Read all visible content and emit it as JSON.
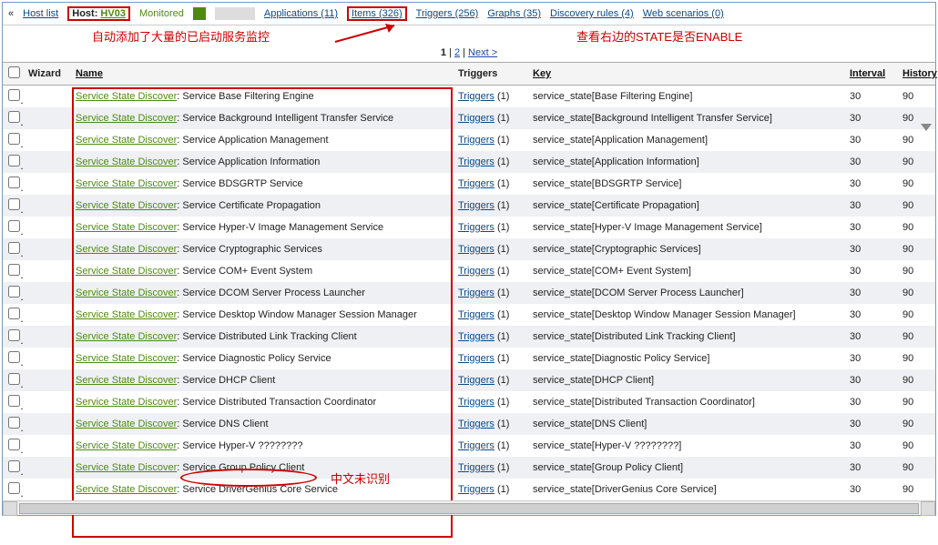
{
  "nav": {
    "host_list": "Host list",
    "host_label": "Host:",
    "host_value": "HV03",
    "monitored": "Monitored",
    "applications": "Applications (11)",
    "items": "Items (326)",
    "triggers": "Triggers (256)",
    "graphs": "Graphs (35)",
    "discovery": "Discovery rules (4)",
    "web": "Web scenarios (0)"
  },
  "annot": {
    "left": "自动添加了大量的已启动服务监控",
    "right": "查看右边的STATE是否ENABLE",
    "cn_unrec": "中文未识别"
  },
  "pager": {
    "p1": "1",
    "p2": "2",
    "next": "Next >"
  },
  "headers": {
    "wizard": "Wizard",
    "name": "Name",
    "triggers": "Triggers",
    "key": "Key",
    "interval": "Interval",
    "history": "History"
  },
  "discover_label": "Service State Discover",
  "triggers_label": "Triggers",
  "triggers_count": "(1)",
  "interval_val": "30",
  "history_val": "90",
  "rows": [
    {
      "svc": "Service Base Filtering Engine",
      "key": "service_state[Base Filtering Engine]"
    },
    {
      "svc": "Service Background Intelligent Transfer Service",
      "key": "service_state[Background Intelligent Transfer Service]"
    },
    {
      "svc": "Service Application Management",
      "key": "service_state[Application Management]"
    },
    {
      "svc": "Service Application Information",
      "key": "service_state[Application Information]"
    },
    {
      "svc": "Service BDSGRTP Service",
      "key": "service_state[BDSGRTP Service]"
    },
    {
      "svc": "Service Certificate Propagation",
      "key": "service_state[Certificate Propagation]"
    },
    {
      "svc": "Service Hyper-V Image Management Service",
      "key": "service_state[Hyper-V Image Management Service]"
    },
    {
      "svc": "Service Cryptographic Services",
      "key": "service_state[Cryptographic Services]"
    },
    {
      "svc": "Service COM+ Event System",
      "key": "service_state[COM+ Event System]"
    },
    {
      "svc": "Service DCOM Server Process Launcher",
      "key": "service_state[DCOM Server Process Launcher]"
    },
    {
      "svc": "Service Desktop Window Manager Session Manager",
      "key": "service_state[Desktop Window Manager Session Manager]"
    },
    {
      "svc": "Service Distributed Link Tracking Client",
      "key": "service_state[Distributed Link Tracking Client]"
    },
    {
      "svc": "Service Diagnostic Policy Service",
      "key": "service_state[Diagnostic Policy Service]"
    },
    {
      "svc": "Service DHCP Client",
      "key": "service_state[DHCP Client]"
    },
    {
      "svc": "Service Distributed Transaction Coordinator",
      "key": "service_state[Distributed Transaction Coordinator]"
    },
    {
      "svc": "Service DNS Client",
      "key": "service_state[DNS Client]"
    },
    {
      "svc": "Service Hyper-V ????????",
      "key": "service_state[Hyper-V ????????]"
    },
    {
      "svc": "Service Group Policy Client",
      "key": "service_state[Group Policy Client]"
    },
    {
      "svc": "Service DriverGenius Core Service",
      "key": "service_state[DriverGenius Core Service]"
    }
  ]
}
